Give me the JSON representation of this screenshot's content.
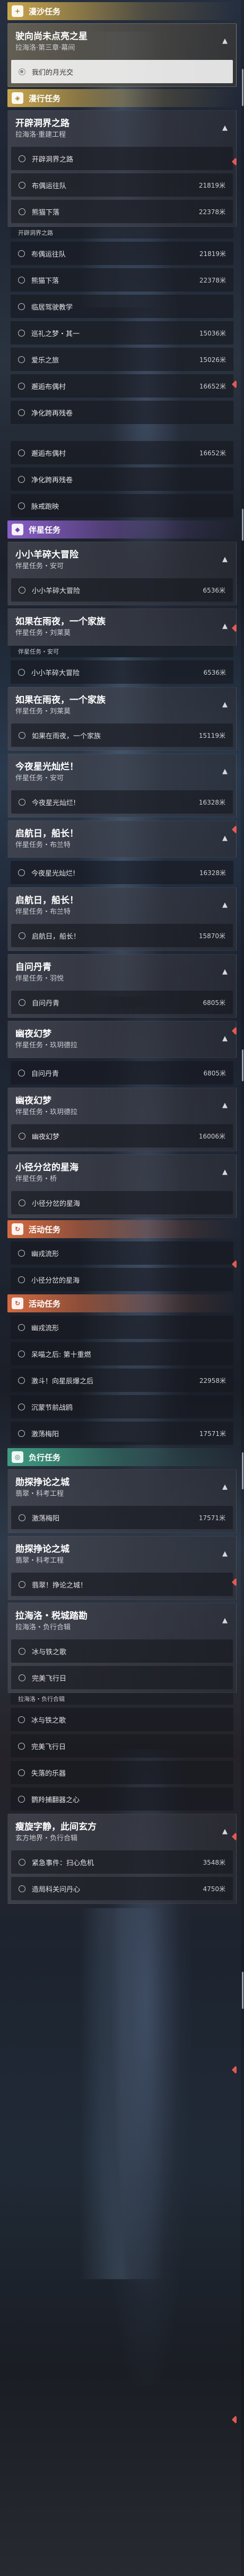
{
  "background": {
    "image": "character-artwork",
    "accent_colors": {
      "trailblaze": "#c9a64c",
      "companion": "#8a5ec8",
      "event": "#d46a40",
      "adventure": "#3f9c82"
    }
  },
  "sections": [
    {
      "kind": "cat",
      "type": "trail",
      "icon": "+",
      "label": "漫沙任务"
    },
    {
      "kind": "card",
      "active": true,
      "title": "驶向尚未点亮之星",
      "subs": [
        "拉海洛·第三章·幕间"
      ],
      "rows": [
        {
          "label": "我们的月光交",
          "done": true
        }
      ]
    },
    {
      "kind": "cat",
      "type": "trail",
      "icon": "◈",
      "label": "漫行任务"
    },
    {
      "kind": "card",
      "title": "开辟洞界之路",
      "subs": [
        "拉海洛·重建工程"
      ],
      "rows": [
        {
          "label": "开辟洞界之路"
        },
        {
          "label": "布偶运往队",
          "dist": "21819米"
        },
        {
          "label": "熊猫下落",
          "dist": "22378米"
        }
      ]
    },
    {
      "kind": "cap",
      "label": "开辟洞界之路"
    },
    {
      "kind": "rows",
      "rows": [
        {
          "label": "布偶运往队",
          "dist": "21819米"
        },
        {
          "label": "熊猫下落",
          "dist": "22378米"
        },
        {
          "label": "临居驾驶教学"
        },
        {
          "label": "巡礼之梦・其一",
          "dist": "15036米"
        },
        {
          "label": "爱乐之旅",
          "dist": "15026米"
        },
        {
          "label": "邂逅布偶村",
          "dist": "16652米"
        },
        {
          "label": "净化跨再残卷"
        }
      ]
    },
    {
      "kind": "gap"
    },
    {
      "kind": "rows",
      "rows": [
        {
          "label": "邂逅布偶村",
          "dist": "16652米"
        },
        {
          "label": "净化跨再残卷"
        },
        {
          "label": "脉戒跑映"
        }
      ]
    },
    {
      "kind": "cat",
      "type": "comp",
      "icon": "◆",
      "label": "伴星任务"
    },
    {
      "kind": "card",
      "title": "小小羊碎大冒险",
      "subs": [
        "伴星任务・安可"
      ],
      "rows": [
        {
          "label": "小小羊碎大冒险",
          "dist": "6536米"
        }
      ]
    },
    {
      "kind": "card",
      "title": "如果在雨夜，一个家族",
      "subs": [
        "伴星任务・刘莱莫"
      ],
      "rows": []
    },
    {
      "kind": "cap",
      "label": "伴星任务・安可"
    },
    {
      "kind": "rows",
      "rows": [
        {
          "label": "小小羊碎大冒险",
          "dist": "6536米"
        }
      ]
    },
    {
      "kind": "card",
      "title": "如果在雨夜，一个家族",
      "subs": [
        "伴星任务・刘莱莫"
      ],
      "rows": [
        {
          "label": "如果在雨夜，一个家族",
          "dist": "15119米"
        }
      ]
    },
    {
      "kind": "card",
      "title": "今夜星光灿烂！",
      "subs": [
        "伴星任务・安可"
      ],
      "rows": [
        {
          "label": "今夜星光灿烂!",
          "dist": "16328米"
        }
      ]
    },
    {
      "kind": "card",
      "title": "启航日，船长！",
      "subs": [
        "伴星任务・布兰特"
      ],
      "rows": []
    },
    {
      "kind": "rows",
      "rows": [
        {
          "label": "今夜星光灿烂!",
          "dist": "16328米"
        }
      ]
    },
    {
      "kind": "card",
      "title": "启航日，船长！",
      "subs": [
        "伴星任务・布兰特"
      ],
      "rows": [
        {
          "label": "启航日，船长！",
          "dist": "15870米"
        }
      ]
    },
    {
      "kind": "card",
      "title": "自问丹青",
      "subs": [
        "伴星任务・羽悦"
      ],
      "rows": [
        {
          "label": "自问丹青",
          "dist": "6805米"
        }
      ]
    },
    {
      "kind": "card",
      "title": "幽夜幻梦",
      "subs": [
        "伴星任务・玖玥德拉"
      ],
      "rows": []
    },
    {
      "kind": "rows",
      "rows": [
        {
          "label": "自问丹青",
          "dist": "6805米"
        }
      ]
    },
    {
      "kind": "card",
      "title": "幽夜幻梦",
      "subs": [
        "伴星任务・玖玥德拉"
      ],
      "rows": [
        {
          "label": "幽夜幻梦",
          "dist": "16006米"
        }
      ]
    },
    {
      "kind": "card",
      "title": "小径分岔的星海",
      "subs": [
        "伴星任务・桥"
      ],
      "rows": [
        {
          "label": "小径分岔的星海"
        }
      ]
    },
    {
      "kind": "cat",
      "type": "event",
      "icon": "↻",
      "label": "活动任务"
    },
    {
      "kind": "rows",
      "rows": [
        {
          "label": "幽戎流形"
        },
        {
          "label": "小径分岔的星海"
        }
      ]
    },
    {
      "kind": "cat",
      "type": "event",
      "icon": "↻",
      "label": "活动任务"
    },
    {
      "kind": "rows",
      "rows": [
        {
          "label": "幽戎流形"
        },
        {
          "label": "呆喵之后: 第十重燃"
        },
        {
          "label": "激斗！向星辰爆之后",
          "dist": "22958米"
        },
        {
          "label": "沉蒙节前战鸥"
        },
        {
          "label": "激荡梅阳",
          "dist": "17571米"
        }
      ]
    },
    {
      "kind": "cat",
      "type": "adv",
      "icon": "◎",
      "label": "负行任务"
    },
    {
      "kind": "card",
      "title": "勋探挣论之城",
      "subs": [
        "翡翠・科考工程"
      ],
      "rows": [
        {
          "label": "激荡梅阳",
          "dist": "17571米"
        }
      ]
    },
    {
      "kind": "card",
      "title": "勋探挣论之城",
      "subs": [
        "翡翠・科考工程"
      ],
      "rows": [
        {
          "label": "翡翠！挣论之城！"
        }
      ]
    },
    {
      "kind": "card",
      "title": "拉海洛・税城踏勘",
      "subs": [
        "拉海洛・负行合辑"
      ],
      "rows": [
        {
          "label": "冰与铁之歌"
        },
        {
          "label": "完美飞行日"
        }
      ]
    },
    {
      "kind": "cap",
      "label": "拉海洛・负行合辑"
    },
    {
      "kind": "rows",
      "rows": [
        {
          "label": "冰与铁之歌"
        },
        {
          "label": "完美飞行日"
        },
        {
          "label": "失落的乐器"
        },
        {
          "label": "鹦羚捕翻器之心"
        }
      ]
    },
    {
      "kind": "card",
      "title": "瘦旋字静，此间玄方",
      "subs": [
        "玄方地界・负行合辑"
      ],
      "rows": [
        {
          "label": "紧急事件：扫心危机",
          "dist": "3548米"
        },
        {
          "label": "造局科关问丹心",
          "dist": "4750米"
        }
      ]
    }
  ]
}
